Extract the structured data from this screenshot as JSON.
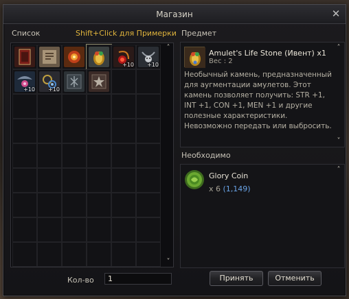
{
  "window": {
    "title": "Магазин"
  },
  "left": {
    "list_label": "Список",
    "tryon_hint": "Shift+Click для Примерки"
  },
  "right": {
    "item_label": "Предмет",
    "required_label": "Необходимо"
  },
  "items": [
    {
      "icon": "book-icon",
      "bg": "#3a1a16",
      "plus": ""
    },
    {
      "icon": "scroll-icon",
      "bg": "#6a5a48",
      "plus": ""
    },
    {
      "icon": "flower-icon",
      "bg": "#5a2a10",
      "plus": ""
    },
    {
      "icon": "life-stone-icon",
      "bg": "#3a4040",
      "plus": ""
    },
    {
      "icon": "red-pendant-icon",
      "bg": "#2a1a18",
      "plus": "+10"
    },
    {
      "icon": "skull-necklace-icon",
      "bg": "#2a2e34",
      "plus": "+10"
    },
    {
      "icon": "winged-necklace-icon",
      "bg": "#1e2a3a",
      "plus": "+10"
    },
    {
      "icon": "chain-ring-icon",
      "bg": "#2a2a30",
      "plus": "+10"
    },
    {
      "icon": "dark-rune-icon",
      "bg": "#2c3236",
      "plus": ""
    },
    {
      "icon": "star-rune-icon",
      "bg": "#3a2a26",
      "plus": ""
    }
  ],
  "item": {
    "name": "Amulet's Life Stone (Ивент) x1",
    "weight": "Вес : 2",
    "description": "Необычный камень, предназначенный для аугментации амулетов. Этот камень позволяет получить: STR +1, INT +1, CON +1, MEN +1 и другие полезные характеристики. Невозможно передать или выбросить."
  },
  "required": {
    "name": "Glory Coin",
    "qty": "x 6",
    "owned": "(1,149)"
  },
  "footer": {
    "qty_label": "Кол-во",
    "qty_value": "1",
    "accept_label": "Принять",
    "cancel_label": "Отменить"
  },
  "colors": {
    "accent_hint": "#e0b43c",
    "owned_count": "#6aa4e8"
  }
}
